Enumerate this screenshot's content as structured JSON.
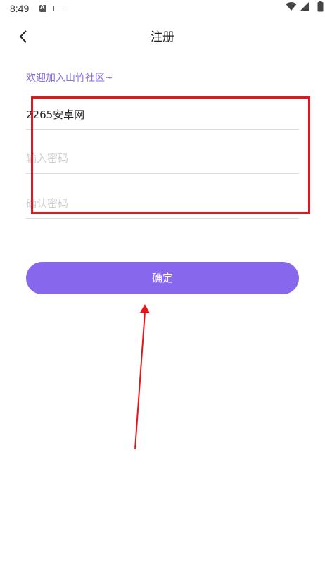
{
  "status_bar": {
    "time": "8:49"
  },
  "header": {
    "title": "注册",
    "back_icon": "chevron-left-icon"
  },
  "form": {
    "welcome": "欢迎加入山竹社区~",
    "username_value": "2265安卓网",
    "password_placeholder": "输入密码",
    "confirm_placeholder": "确认密码",
    "submit_label": "确定"
  },
  "colors": {
    "accent": "#8767ec",
    "welcome_text": "#8a6de9",
    "annotation": "#e8141b"
  }
}
